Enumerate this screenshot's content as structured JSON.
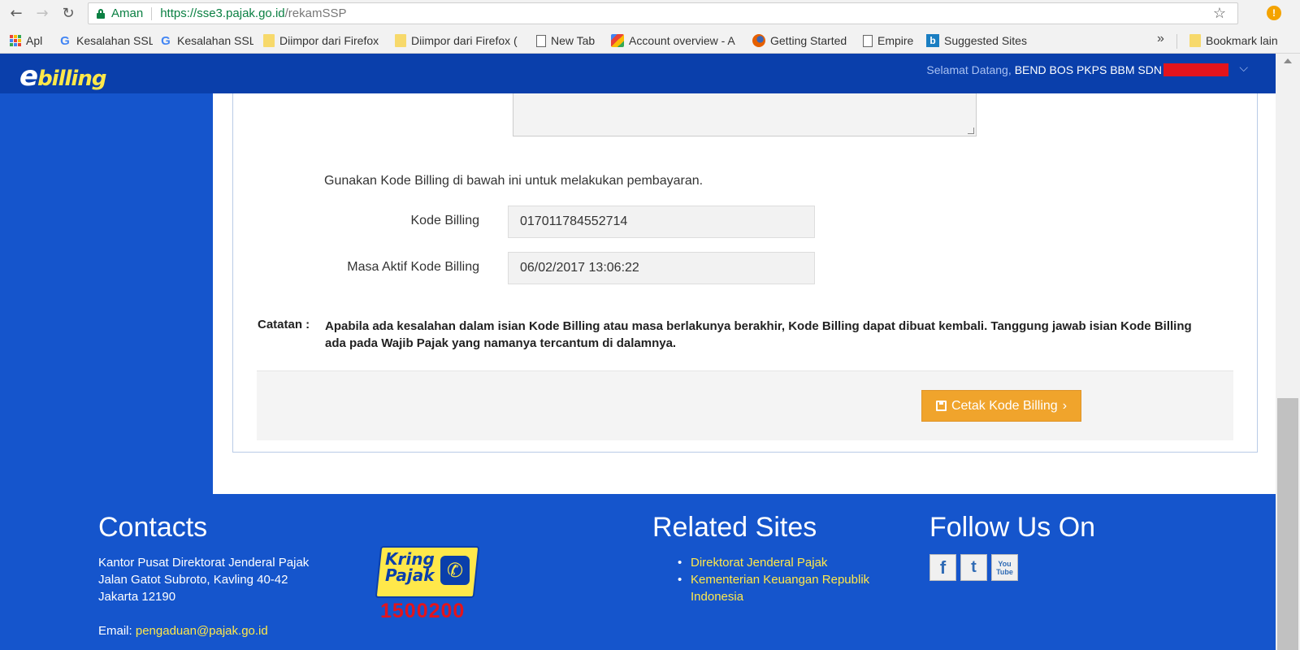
{
  "browser": {
    "back_glyph": "←",
    "forward_glyph": "→",
    "reload_glyph": "↻",
    "secure_label": "Aman",
    "url_host": "https://sse3.pajak.go.id",
    "url_path": "/rekamSSP",
    "star_glyph": "☆",
    "update_glyph": "!"
  },
  "bookmarks": {
    "items": [
      {
        "label": "Apl",
        "icon": "apps-icon"
      },
      {
        "label": "Kesalahan SSL",
        "icon": "google-icon"
      },
      {
        "label": "Kesalahan SSL",
        "icon": "google-icon"
      },
      {
        "label": "Diimpor dari Firefox",
        "icon": "folder-icon"
      },
      {
        "label": "Diimpor dari Firefox (",
        "icon": "folder-icon"
      },
      {
        "label": "New Tab",
        "icon": "page-icon"
      },
      {
        "label": "Account overview - A",
        "icon": "multicolor-icon"
      },
      {
        "label": "Getting Started",
        "icon": "firefox-icon"
      },
      {
        "label": "Empire",
        "icon": "page-icon"
      },
      {
        "label": "Suggested Sites",
        "icon": "bing-icon"
      }
    ],
    "more_glyph": "»",
    "other_label": "Bookmark lain"
  },
  "header": {
    "logo_e": "e",
    "logo_text": "billing",
    "welcome_prefix": "Selamat Datang,",
    "user_name": "BEND BOS PKPS BBM SDN",
    "chevron_glyph": "⌵"
  },
  "billing": {
    "instruction": "Gunakan Kode Billing di bawah ini untuk melakukan pembayaran.",
    "code_label": "Kode Billing",
    "code_value": "017011784552714",
    "active_label": "Masa Aktif Kode Billing",
    "active_value": "06/02/2017 13:06:22",
    "note_label": "Catatan :",
    "note_text": "Apabila ada kesalahan dalam isian Kode Billing atau masa berlakunya berakhir, Kode Billing dapat dibuat kembali. Tanggung jawab isian Kode Billing ada pada Wajib Pajak yang namanya tercantum di dalamnya.",
    "print_button": "Cetak Kode Billing",
    "print_arrow": "›"
  },
  "footer": {
    "contacts_title": "Contacts",
    "address_line1": "Kantor Pusat Direktorat Jenderal Pajak",
    "address_line2": "Jalan Gatot Subroto, Kavling 40-42",
    "address_line3": "Jakarta 12190",
    "email_label": "Email:",
    "email_value": "pengaduan@pajak.go.id",
    "kring_line1": "Kring",
    "kring_line2": "Pajak",
    "kring_number": "1500200",
    "related_title": "Related Sites",
    "related_links": [
      "Direktorat Jenderal Pajak",
      "Kementerian Keuangan Republik Indonesia"
    ],
    "follow_title": "Follow Us On",
    "social": [
      {
        "label": "f",
        "icon": "facebook-icon"
      },
      {
        "label": "t",
        "icon": "twitter-icon"
      },
      {
        "label": "You Tube",
        "icon": "youtube-icon"
      }
    ]
  },
  "colors": {
    "brand_blue": "#1555cc",
    "header_blue": "#0a3fab",
    "accent_yellow": "#ffe84a",
    "button_orange": "#f0a42c",
    "redaction_red": "#e3141c"
  }
}
